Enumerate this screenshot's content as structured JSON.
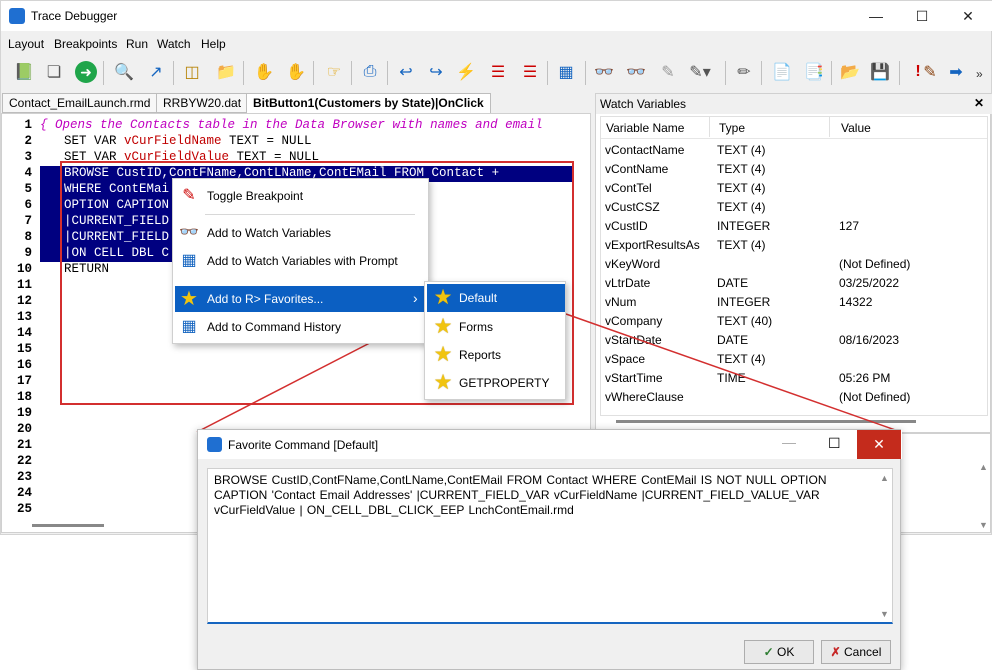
{
  "window": {
    "title": "Trace Debugger"
  },
  "menu": [
    "Layout",
    "Breakpoints",
    "Run",
    "Watch",
    "Help"
  ],
  "tabs": [
    "Contact_EmailLaunch.rmd",
    "RRBYW20.dat",
    "BitButton1(Customers by State)|OnClick"
  ],
  "editor": {
    "lines": [
      {
        "n": "1",
        "text": "{ Opens the Contacts table in the Data Browser with names and email"
      },
      {
        "n": "2",
        "a": "SET VAR ",
        "v": "vCurFieldName",
        "b": " TEXT = NULL"
      },
      {
        "n": "3",
        "a": "SET VAR ",
        "v": "vCurFieldValue",
        "b": " TEXT = NULL"
      },
      {
        "n": "4",
        "text": "BROWSE CustID,ContFName,ContLName,ContEMail FROM Contact +"
      },
      {
        "n": "5",
        "text": "WHERE ContEMai"
      },
      {
        "n": "6",
        "text": "OPTION CAPTION"
      },
      {
        "n": "7",
        "text": "|CURRENT_FIELD"
      },
      {
        "n": "8",
        "text": "|CURRENT_FIELD"
      },
      {
        "n": "9",
        "text": "|ON CELL DBL C"
      },
      {
        "n": "10",
        "text": "RETURN"
      },
      {
        "n": "11"
      },
      {
        "n": "12"
      },
      {
        "n": "13"
      },
      {
        "n": "14"
      },
      {
        "n": "15"
      },
      {
        "n": "16"
      },
      {
        "n": "17"
      },
      {
        "n": "18"
      },
      {
        "n": "19"
      },
      {
        "n": "20"
      },
      {
        "n": "21"
      },
      {
        "n": "22"
      },
      {
        "n": "23"
      },
      {
        "n": "24"
      },
      {
        "n": "25"
      }
    ]
  },
  "watch": {
    "title": "Watch Variables",
    "close": "✕",
    "columns": [
      "Variable Name",
      "Type",
      "Value"
    ],
    "rows": [
      [
        "vContactName",
        "TEXT (4)",
        ""
      ],
      [
        "vContName",
        "TEXT (4)",
        ""
      ],
      [
        "vContTel",
        "TEXT (4)",
        ""
      ],
      [
        "vCustCSZ",
        "TEXT (4)",
        ""
      ],
      [
        "vCustID",
        "INTEGER",
        "127"
      ],
      [
        "vExportResultsAs",
        "TEXT (4)",
        ""
      ],
      [
        "vKeyWord",
        "",
        "(Not Defined)"
      ],
      [
        "vLtrDate",
        "DATE",
        "03/25/2022"
      ],
      [
        "vNum",
        "INTEGER",
        "14322"
      ],
      [
        "vCompany",
        "TEXT (40)",
        ""
      ],
      [
        "vStartDate",
        "DATE",
        "08/16/2023"
      ],
      [
        "vSpace",
        "TEXT (4)",
        ""
      ],
      [
        "vStartTime",
        "TIME",
        "05:26 PM"
      ],
      [
        "vWhereClause",
        "",
        "(Not Defined)"
      ]
    ]
  },
  "context_menu": {
    "items": [
      "Toggle Breakpoint",
      "Add to Watch Variables",
      "Add to Watch Variables with Prompt",
      "Add to R> Favorites...",
      "Add to Command History"
    ],
    "arrow": "›"
  },
  "submenu": {
    "items": [
      "Default",
      "Forms",
      "Reports",
      "GETPROPERTY"
    ]
  },
  "dialog": {
    "title": "Favorite Command [Default]",
    "text": "BROWSE CustID,ContFName,ContLName,ContEMail FROM Contact    WHERE ContEMail IS NOT NULL    OPTION CAPTION 'Contact Email Addresses'    |CURRENT_FIELD_VAR vCurFieldName    |CURRENT_FIELD_VALUE_VAR vCurFieldValue    | ON_CELL_DBL_CLICK_EEP LnchContEmail.rmd",
    "ok": "OK",
    "cancel": "Cancel"
  },
  "colors": {
    "selection": "#000080",
    "highlight": "#0b5fc2",
    "callout": "#d32f2f"
  }
}
